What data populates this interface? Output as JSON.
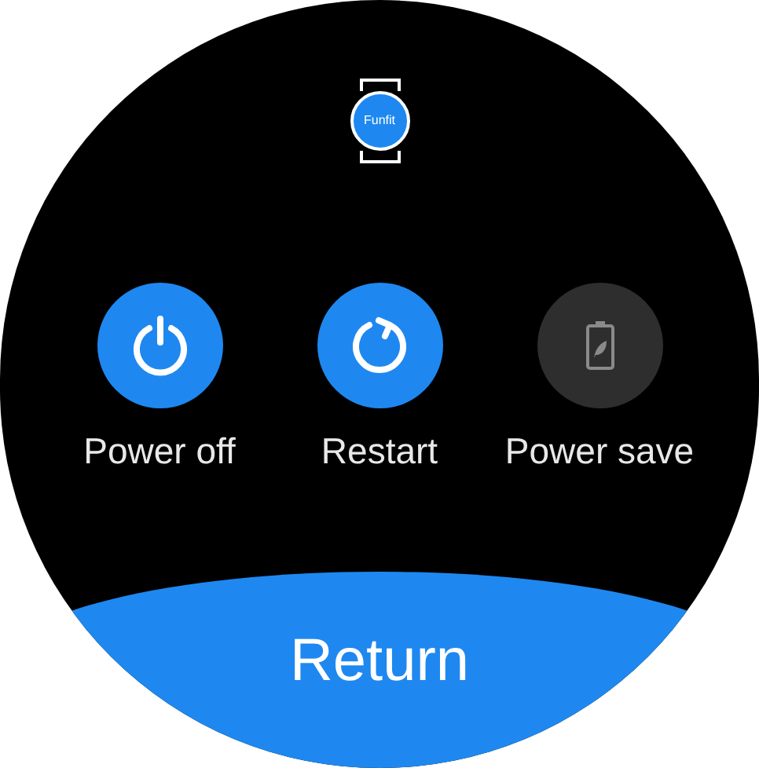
{
  "logo": {
    "text": "Funfit"
  },
  "actions": [
    {
      "kind": "power",
      "label": "Power off",
      "disabled": false
    },
    {
      "kind": "restart",
      "label": "Restart",
      "disabled": false
    },
    {
      "kind": "battery",
      "label": "Power save",
      "disabled": true
    }
  ],
  "return_button": {
    "label": "Return"
  }
}
